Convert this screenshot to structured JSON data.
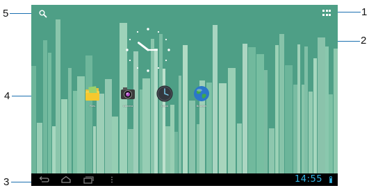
{
  "callouts": [
    "1",
    "2",
    "3",
    "4",
    "5"
  ],
  "clock": {
    "hour": 10,
    "minute": 15
  },
  "apps": [
    {
      "label": "Files",
      "icon": "folder-icon"
    },
    {
      "label": "Camera",
      "icon": "camera-icon"
    },
    {
      "label": "Clock",
      "icon": "clock-icon"
    },
    {
      "label": "Browser",
      "icon": "globe-icon"
    }
  ],
  "status_bar": {
    "time": "14:55"
  },
  "colors": {
    "wallpaper": "#4e9f86",
    "callout_line": "#1a6fb0",
    "clock_text": "#33b5e5",
    "nav_bar": "#000000"
  }
}
